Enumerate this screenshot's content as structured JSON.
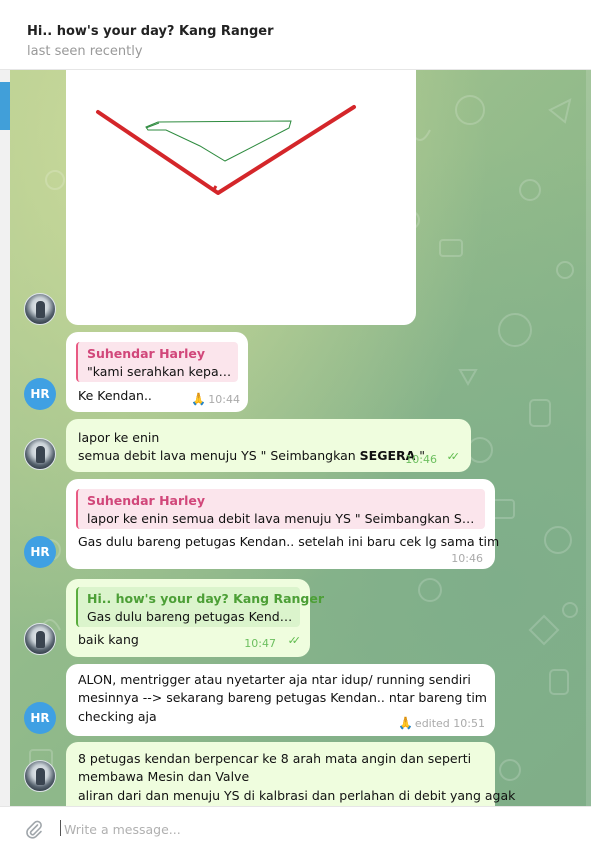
{
  "header": {
    "title": "Hi.. how's your day? Kang Ranger",
    "status": "last seen recently"
  },
  "messages": [
    {
      "type": "image",
      "sender": "photo"
    },
    {
      "sender_initials": "HR",
      "reply": {
        "name": "Suhendar Harley",
        "text": "\"kami serahkan kepad..."
      },
      "text": "Ke Kendan..",
      "time": "10:44",
      "reaction": "🙏"
    },
    {
      "outgoing": true,
      "lines": [
        "lapor ke enin",
        "semua debit lava menuju YS \" Seimbangkan SEGERA \""
      ],
      "time": "10:46"
    },
    {
      "sender_initials": "HR",
      "reply": {
        "name": "Suhendar Harley",
        "text": "lapor ke enin  semua debit lava menuju YS \" Seimbangkan SEGE..."
      },
      "text": "Gas dulu bareng petugas Kendan.. setelah ini baru cek lg sama tim",
      "time": "10:46"
    },
    {
      "outgoing": true,
      "reply": {
        "name": "Hi.. how's your day? Kang Ranger",
        "text": "Gas dulu bareng petugas Kendan..."
      },
      "text": "baik kang",
      "time": "10:47"
    },
    {
      "sender_initials": "HR",
      "lines": [
        "ALON, mentrigger atau nyetarter aja ntar idup/ running sendiri",
        "mesinnya --> sekarang bareng petugas Kendan.. ntar bareng tim",
        "checking aja"
      ],
      "time": "edited 10:51",
      "reaction": "🙏"
    },
    {
      "outgoing": true,
      "lines": [
        "8 petugas kendan berpencar ke 8 arah mata angin  dan seperti",
        "membawa Mesin dan Valve",
        "aliran dari dan menuju YS di kalbrasi dan perlahan di debit yang agak"
      ]
    }
  ],
  "composer": {
    "placeholder": "Write a message..."
  },
  "icons": {
    "attach": "paperclip-icon",
    "read": "double-check-icon"
  },
  "colors": {
    "accent": "#419fd9",
    "outgoing_bubble": "#effdde",
    "incoming_bubble": "#ffffff",
    "avatar_hr": "#3fa0e3"
  }
}
